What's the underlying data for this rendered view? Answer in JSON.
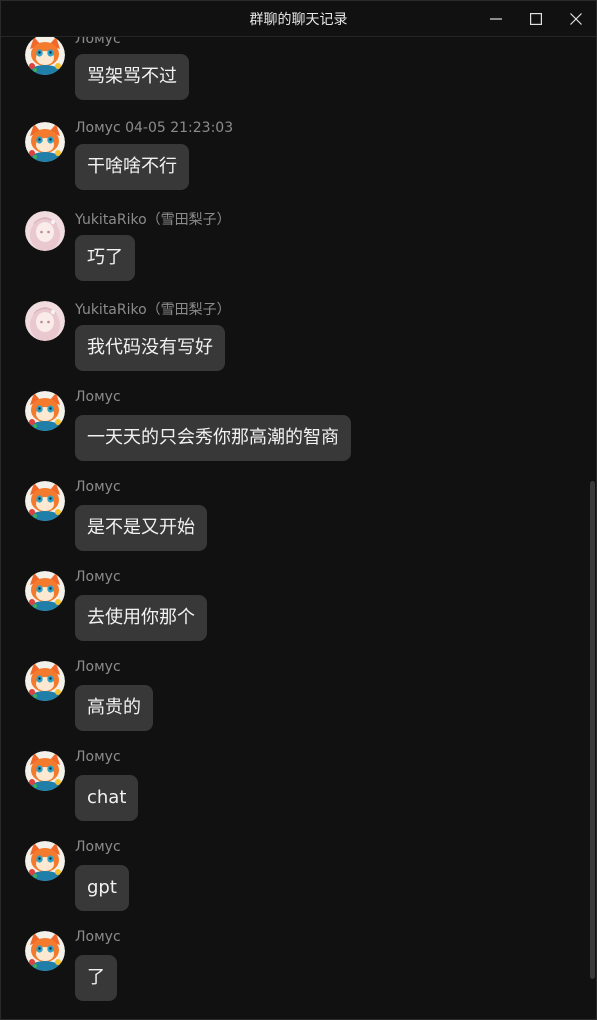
{
  "window": {
    "title": "群聊的聊天记录",
    "controls": [
      "minimize-icon",
      "maximize-icon",
      "close-icon"
    ]
  },
  "colors": {
    "background": "#111111",
    "bubble": "#383838",
    "sender_text": "#8c8c8c",
    "message_text": "#f2f2f2"
  },
  "messages": [
    {
      "sender": "Ломус",
      "text": "骂架骂不过",
      "avatar": "fox-avatar"
    },
    {
      "sender": "Ломус 04-05 21:23:03",
      "text": "干啥啥不行",
      "avatar": "fox-avatar"
    },
    {
      "sender": "YukitaRiko（雪田梨子）",
      "text": "巧了",
      "avatar": "girl-avatar"
    },
    {
      "sender": "YukitaRiko（雪田梨子）",
      "text": "我代码没有写好",
      "avatar": "girl-avatar"
    },
    {
      "sender": "Ломус",
      "text": "一天天的只会秀你那高潮的智商",
      "avatar": "fox-avatar"
    },
    {
      "sender": "Ломус",
      "text": "是不是又开始",
      "avatar": "fox-avatar"
    },
    {
      "sender": "Ломус",
      "text": "去使用你那个",
      "avatar": "fox-avatar"
    },
    {
      "sender": "Ломус",
      "text": "高贵的",
      "avatar": "fox-avatar"
    },
    {
      "sender": "Ломус",
      "text": "chat",
      "avatar": "fox-avatar"
    },
    {
      "sender": "Ломус",
      "text": "gpt",
      "avatar": "fox-avatar"
    },
    {
      "sender": "Ломус",
      "text": "了",
      "avatar": "fox-avatar"
    }
  ]
}
